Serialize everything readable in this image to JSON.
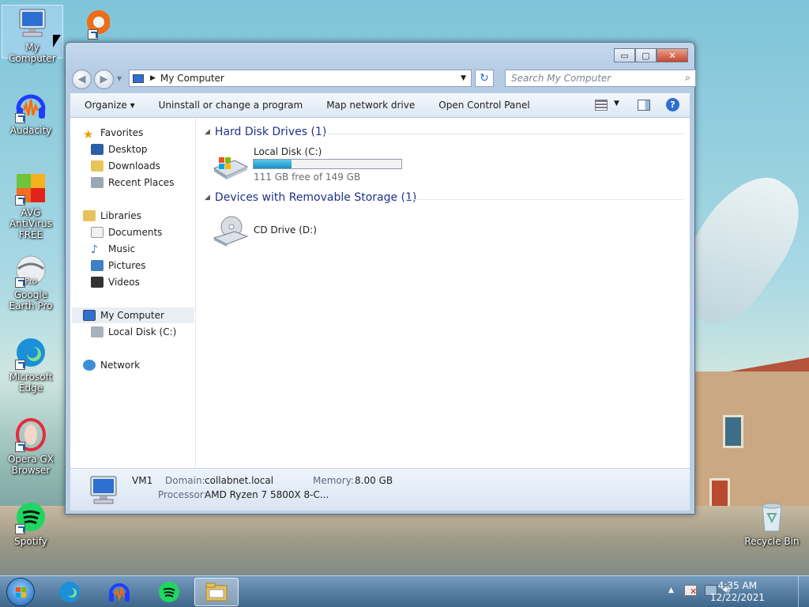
{
  "desktop_icons": [
    {
      "label": "My Computer"
    },
    {
      "label": "Audacity"
    },
    {
      "label": "AVG AntiVirus FREE"
    },
    {
      "label": "Google Earth Pro",
      "badge": "Pro"
    },
    {
      "label": "Microsoft Edge"
    },
    {
      "label": "Opera GX Browser"
    },
    {
      "label": "Spotify"
    },
    {
      "label": "Recycle Bin"
    }
  ],
  "window": {
    "controls": {
      "minimize": "▭",
      "maximize": "▢",
      "close": "✕"
    },
    "address": {
      "path": "My Computer",
      "refresh": "↻"
    },
    "search_placeholder": "Search My Computer",
    "toolbar": {
      "organize": "Organize",
      "uninstall": "Uninstall or change a program",
      "map_drive": "Map network drive",
      "control_panel": "Open Control Panel",
      "help": "?"
    },
    "sidebar": {
      "favorites": "Favorites",
      "desktop": "Desktop",
      "downloads": "Downloads",
      "recent": "Recent Places",
      "libraries": "Libraries",
      "documents": "Documents",
      "music": "Music",
      "pictures": "Pictures",
      "videos": "Videos",
      "computer": "My Computer",
      "local_disk": "Local Disk (C:)",
      "network": "Network"
    },
    "groups": {
      "hdd": {
        "title": "Hard Disk Drives (1)",
        "drive_name": "Local Disk (C:)",
        "free_text": "111 GB free of 149 GB",
        "used_fraction": 0.255
      },
      "removable": {
        "title": "Devices with Removable Storage (1)",
        "drive_name": "CD Drive (D:)"
      }
    },
    "details": {
      "name": "VM1",
      "domain_label": "Domain:",
      "domain": "collabnet.local",
      "memory_label": "Memory:",
      "memory": "8.00 GB",
      "processor_label": "Processor:",
      "processor": "AMD Ryzen 7 5800X 8-C..."
    }
  },
  "taskbar": {
    "time": "4:35 AM",
    "date": "12/22/2021",
    "show_hidden": "▲"
  },
  "colors": {
    "group_title": "#1e3287",
    "bar_fill": "#1e8fc7",
    "taskbar": "#3c648c"
  }
}
